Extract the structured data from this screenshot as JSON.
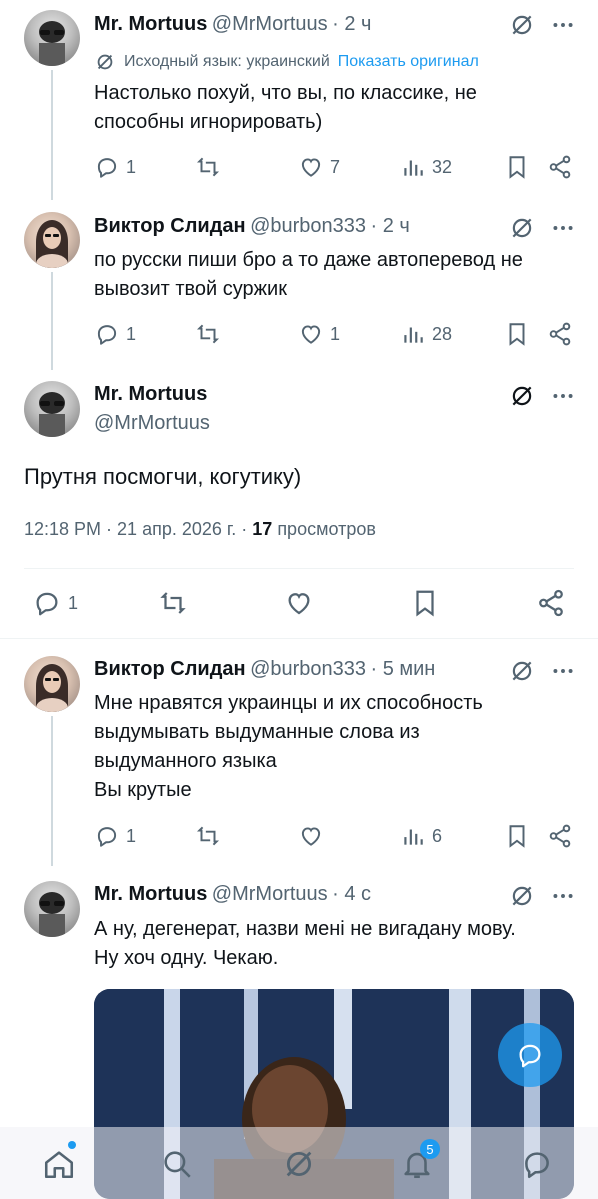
{
  "tweets": [
    {
      "name": "Mr. Mortuus",
      "handle": "@MrMortuus",
      "time": "· 2 ч",
      "translation": {
        "label": "Исходный язык: украинский",
        "link": "Показать оригинал"
      },
      "text": "Настолько похуй, что вы, по классике, не способны игнорировать)",
      "replies": "1",
      "retweets": "",
      "likes": "7",
      "views": "32"
    },
    {
      "name": "Виктор Слидан",
      "handle": "@burbon333",
      "time": "· 2 ч",
      "text": "по русски пиши бро а то даже автоперевод не вывозит твой суржик",
      "replies": "1",
      "retweets": "",
      "likes": "1",
      "views": "28"
    },
    {
      "name": "Виктор Слидан",
      "handle": "@burbon333",
      "time": "· 5 мин",
      "text_lines": [
        "Мне нравятся украинцы и их способность",
        "выдумывать выдуманные слова из",
        "выдуманного языка",
        "Вы крутые"
      ],
      "replies": "1",
      "retweets": "",
      "likes": "",
      "views": "6"
    },
    {
      "name": "Mr. Mortuus",
      "handle": "@MrMortuus",
      "time": "· 4 с",
      "text_lines": [
        "А ну, дегенерат, назви мені не вигадану мову.",
        "Ну хоч одну. Чекаю."
      ]
    }
  ],
  "focused": {
    "name": "Mr. Mortuus",
    "handle": "@MrMortuus",
    "text": "Прутня посмогчи, когутику)",
    "time": "12:18 PM · 21 апр. 2026 г. ·",
    "views_count": "17",
    "views_label": "просмотров",
    "replies": "1"
  },
  "nav": {
    "notifications_badge": "5"
  },
  "colors": {
    "accent": "#1d9bf0",
    "muted": "#536471",
    "text": "#0f1419"
  },
  "icons": [
    "grok-icon",
    "more-icon",
    "reply-icon",
    "retweet-icon",
    "like-icon",
    "views-icon",
    "bookmark-icon",
    "share-icon",
    "home-icon",
    "search-icon",
    "notifications-icon",
    "messages-icon"
  ]
}
